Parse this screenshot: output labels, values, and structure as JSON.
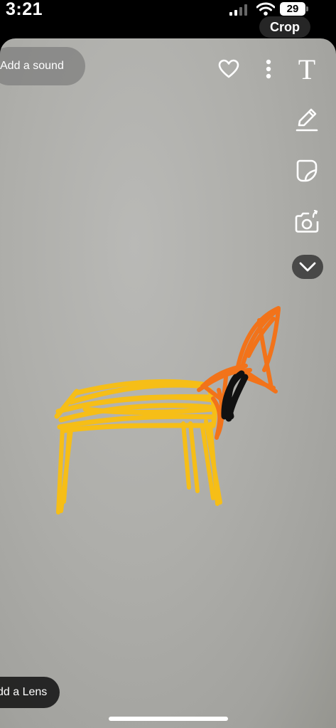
{
  "status_bar": {
    "time": "3:21",
    "battery_level": "29"
  },
  "top_bar": {
    "crop_label": "Crop",
    "add_sound_label": "Add a sound"
  },
  "tools": {
    "text_tool_glyph": "T",
    "icons": [
      "heart-icon",
      "more-vertical-icon",
      "text-tool-icon",
      "pen-icon",
      "sticker-icon",
      "camera-rotate-icon",
      "chevron-down-icon"
    ]
  },
  "bottom": {
    "add_lens_label": "dd a Lens"
  },
  "colors": {
    "stroke_yellow": "#F6BE17",
    "stroke_orange": "#F2731A",
    "stroke_black": "#111111"
  }
}
